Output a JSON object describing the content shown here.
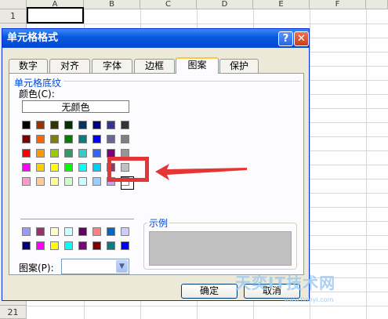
{
  "spreadsheet": {
    "columns": [
      "A",
      "B",
      "C",
      "D",
      "E",
      "F"
    ],
    "rows": [
      "1",
      "21"
    ]
  },
  "dialog": {
    "title": "单元格格式",
    "help_symbol": "?",
    "close_symbol": "✕",
    "tabs": [
      {
        "label": "数字",
        "active": false
      },
      {
        "label": "对齐",
        "active": false
      },
      {
        "label": "字体",
        "active": false
      },
      {
        "label": "边框",
        "active": false
      },
      {
        "label": "图案",
        "active": true
      },
      {
        "label": "保护",
        "active": false
      }
    ],
    "group_title": "单元格底纹",
    "color_label": "颜色(C):",
    "no_color": "无颜色",
    "sample_label": "示例",
    "pattern_label": "图案(P):",
    "pattern_value": "",
    "ok_button": "确定",
    "cancel_button": "取消",
    "sample_color": "#c0c0c0",
    "palette_main": [
      [
        "#000000",
        "#993300",
        "#333300",
        "#003300",
        "#003366",
        "#000080",
        "#333399",
        "#333333"
      ],
      [
        "#800000",
        "#ff6600",
        "#808000",
        "#008000",
        "#008080",
        "#0000ff",
        "#666699",
        "#808080"
      ],
      [
        "#ff0000",
        "#ff9900",
        "#99cc00",
        "#339966",
        "#33cccc",
        "#3366ff",
        "#800080",
        "#969696"
      ],
      [
        "#ff00ff",
        "#ffcc00",
        "#ffff00",
        "#00ff00",
        "#00ffff",
        "#00ccff",
        "#993366",
        "#c0c0c0"
      ],
      [
        "#ff99cc",
        "#ffcc99",
        "#ffff99",
        "#ccffcc",
        "#ccffff",
        "#99ccff",
        "#cc99ff",
        "#ffffff"
      ]
    ],
    "palette_chart": [
      [
        "#9999ff",
        "#993366",
        "#ffffcc",
        "#ccffff",
        "#660066",
        "#ff8080",
        "#0066cc",
        "#ccccff"
      ],
      [
        "#000080",
        "#ff00ff",
        "#ffff00",
        "#00ffff",
        "#800080",
        "#800000",
        "#008080",
        "#0000ff"
      ]
    ]
  },
  "watermark": {
    "text": "天奕IT技术网",
    "subtext": "www.tianyi.com"
  },
  "colors": {
    "title_bar": "#0a5ae0",
    "highlight": "#e53535"
  }
}
